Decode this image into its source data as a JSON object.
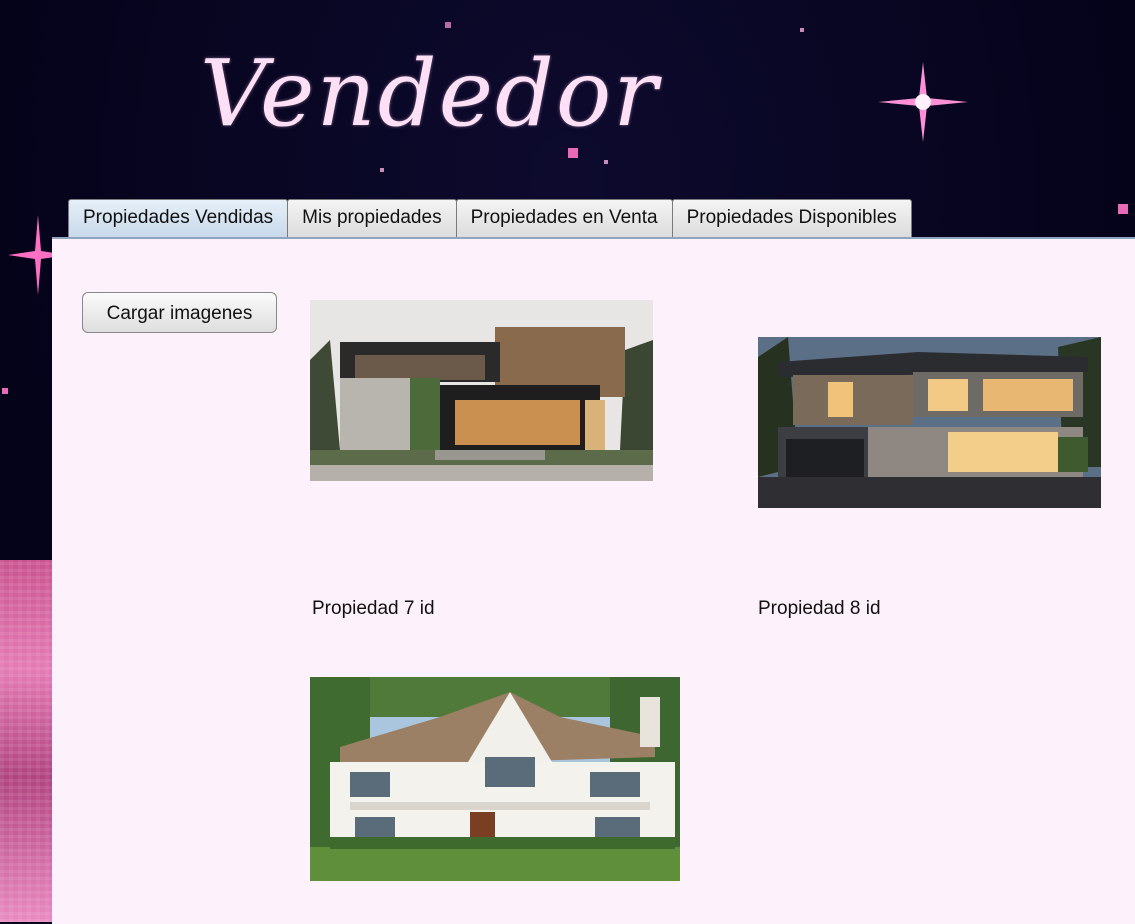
{
  "header": {
    "title": "Vendedor"
  },
  "tabs": [
    {
      "label": "Propiedades Vendidas",
      "active": true
    },
    {
      "label": "Mis propiedades",
      "active": false
    },
    {
      "label": "Propiedades en Venta",
      "active": false
    },
    {
      "label": "Propiedades Disponibles",
      "active": false
    }
  ],
  "toolbar": {
    "load_images_label": "Cargar imagenes"
  },
  "properties": [
    {
      "caption": "Propiedad 7 id"
    },
    {
      "caption": "Propiedad 8 id"
    },
    {
      "caption": ""
    }
  ],
  "colors": {
    "title": "#fde0f5",
    "content_bg": "#fdf2fb",
    "sparkle": "#ff7fd0"
  }
}
